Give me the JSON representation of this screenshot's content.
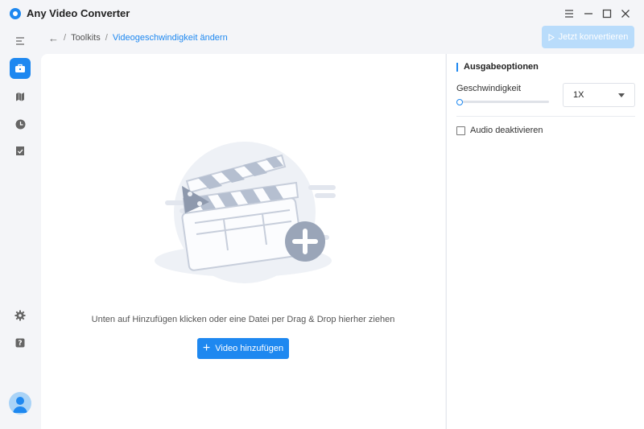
{
  "app": {
    "title": "Any Video Converter"
  },
  "window_controls": {
    "menu_glyph": "☰",
    "minimize_glyph": "–",
    "maximize_glyph": "☐",
    "close_glyph": "✕"
  },
  "breadcrumb": {
    "back_glyph": "←",
    "separator": "/",
    "root": "Toolkits",
    "current": "Videogeschwindigkeit ändern"
  },
  "toolbar": {
    "convert_label": "Jetzt konvertieren",
    "convert_enabled": false
  },
  "main": {
    "hint": "Unten auf Hinzufügen klicken oder eine Datei per Drag & Drop hierher ziehen",
    "add_button_label": "Video hinzufügen",
    "add_glyph": "+"
  },
  "options": {
    "title": "Ausgabeoptionen",
    "speed_label": "Geschwindigkeit",
    "speed_value": "1X",
    "slider_fraction": 0.0,
    "audio_label": "Audio deaktivieren",
    "audio_checked": false
  },
  "colors": {
    "accent": "#1e88f0",
    "accent_disabled": "#b9dcfb",
    "background": "#f4f5f8"
  }
}
